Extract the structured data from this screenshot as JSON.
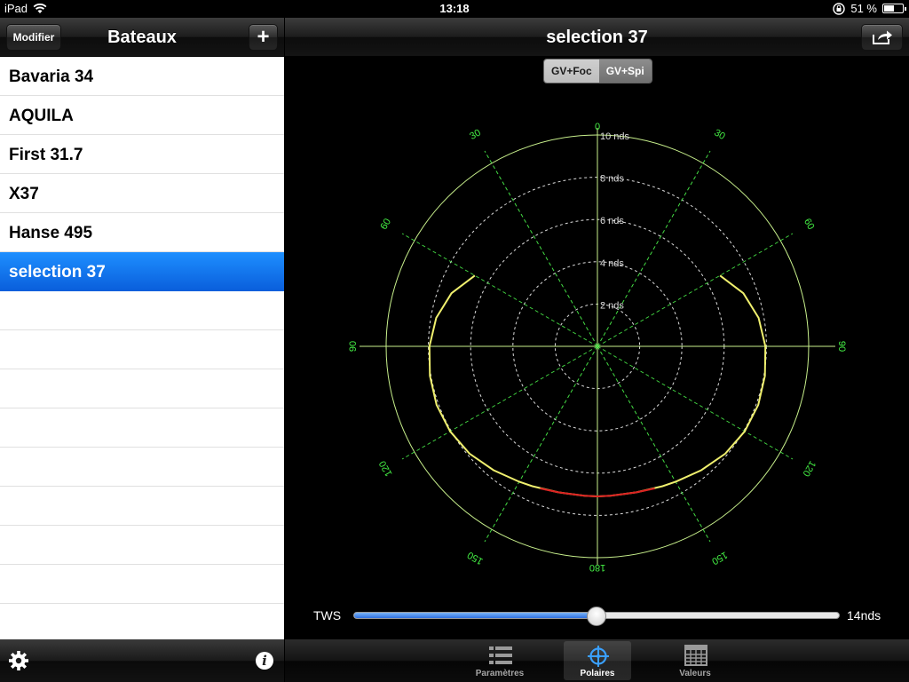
{
  "status_bar": {
    "device": "iPad",
    "time": "13:18",
    "battery": "51 %",
    "battery_level": 0.51
  },
  "left": {
    "title": "Bateaux",
    "modify_label": "Modifier",
    "add_label": "+",
    "boats": [
      "Bavaria 34",
      "AQUILA",
      "First 31.7",
      "X37",
      "Hanse 495",
      "selection 37"
    ],
    "selected_index": 5,
    "info_label": "i"
  },
  "right": {
    "title": "selection 37",
    "segments": [
      "GV+Foc",
      "GV+Spi"
    ],
    "active_segment": 0,
    "tws_label": "TWS",
    "tws_value": "14nds",
    "tws_slider_fraction": 0.5,
    "tabs": [
      {
        "label": "Paramètres",
        "icon": "list-icon"
      },
      {
        "label": "Polaires",
        "icon": "crosshair-icon"
      },
      {
        "label": "Valeurs",
        "icon": "grid-table-icon"
      }
    ],
    "active_tab": 1
  },
  "chart_data": {
    "type": "polar",
    "radial_labels": [
      "2 nds",
      "4 nds",
      "6 nds",
      "8 nds",
      "10 nds"
    ],
    "radial_values": [
      2,
      4,
      6,
      8,
      10
    ],
    "angle_labels_right": [
      "0",
      "30",
      "60",
      "90",
      "120",
      "150",
      "180"
    ],
    "angle_labels_left": [
      "30",
      "60",
      "90",
      "120",
      "150"
    ],
    "angles": [
      0,
      30,
      60,
      90,
      120,
      150,
      180
    ],
    "max_speed": 10,
    "colors": {
      "grid": "#c8f08c",
      "dashed": "#dcdcdc",
      "spoke": "#44dd44",
      "curve": "#f0f06e",
      "highlight": "#dd2222",
      "labels": "#44ee44"
    },
    "series": [
      {
        "name": "",
        "color": "#f0f06e",
        "points": [
          [
            60,
            6.7
          ],
          [
            70,
            7.35
          ],
          [
            80,
            7.75
          ],
          [
            90,
            7.95
          ],
          [
            100,
            8.05
          ],
          [
            110,
            8.1
          ],
          [
            120,
            8.05
          ],
          [
            130,
            7.9
          ],
          [
            140,
            7.65
          ],
          [
            150,
            7.4
          ],
          [
            155,
            7.3
          ],
          [
            160,
            7.2
          ],
          [
            165,
            7.15
          ],
          [
            170,
            7.1
          ],
          [
            175,
            7.1
          ],
          [
            180,
            7.1
          ]
        ]
      },
      {
        "name": "",
        "color": "#dd2222",
        "points": [
          [
            158,
            7.25
          ],
          [
            165,
            7.15
          ],
          [
            170,
            7.1
          ],
          [
            175,
            7.1
          ],
          [
            180,
            7.1
          ]
        ]
      }
    ]
  }
}
